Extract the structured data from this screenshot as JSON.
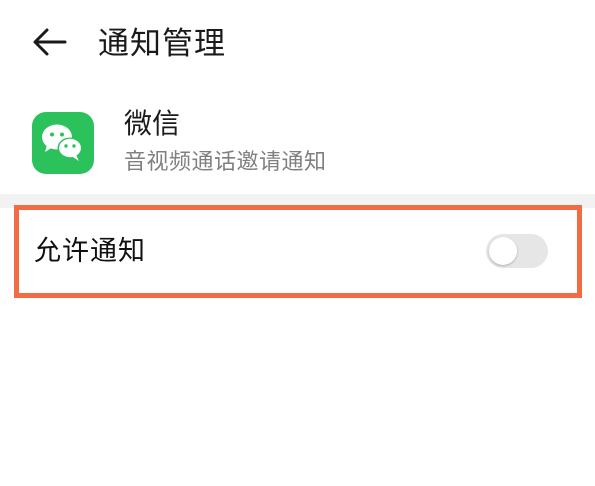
{
  "header": {
    "title": "通知管理",
    "back_icon": "arrow-left-icon"
  },
  "app": {
    "name": "微信",
    "description": "音视频通话邀请通知",
    "icon": "wechat-logo-icon",
    "icon_color": "#2bc25b"
  },
  "settings": {
    "allow_notifications": {
      "label": "允许通知",
      "enabled": false
    }
  },
  "colors": {
    "highlight_border": "#f26b43",
    "toggle_off_track": "#e6e6e6",
    "separator": "#f2f2f2"
  }
}
